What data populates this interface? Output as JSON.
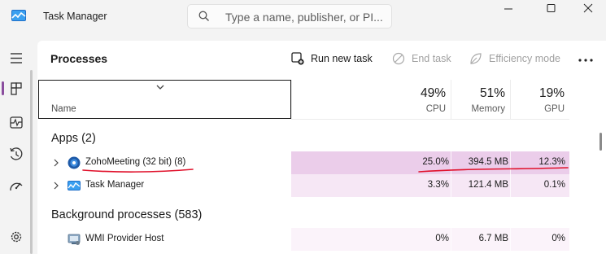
{
  "window": {
    "title": "Task Manager",
    "search_placeholder": "Type a name, publisher, or PI..."
  },
  "nav": {
    "items": [
      "menu-icon",
      "processes-icon",
      "performance-icon",
      "app-history-icon",
      "startup-apps-icon",
      "settings-icon"
    ],
    "active": "processes",
    "accent": "#8a4d9e"
  },
  "toolbar": {
    "page_title": "Processes",
    "run_new_task": "Run new task",
    "end_task": "End task",
    "efficiency_mode": "Efficiency mode"
  },
  "columns": {
    "name": "Name",
    "cpu": {
      "pct": "49%",
      "label": "CPU"
    },
    "memory": {
      "pct": "51%",
      "label": "Memory"
    },
    "gpu": {
      "pct": "19%",
      "label": "GPU"
    }
  },
  "groups": {
    "apps": "Apps (2)",
    "background": "Background processes (583)"
  },
  "rows": [
    {
      "name": "ZohoMeeting (32 bit) (8)",
      "cpu": "25.0%",
      "memory": "394.5 MB",
      "gpu": "12.3%"
    },
    {
      "name": "Task Manager",
      "cpu": "3.3%",
      "memory": "121.4 MB",
      "gpu": "0.1%"
    },
    {
      "name": "WMI Provider Host",
      "cpu": "0%",
      "memory": "6.7 MB",
      "gpu": "0%"
    }
  ],
  "colors": {
    "highlight_strong": "#ebcdea",
    "highlight_light": "#f6e7f5",
    "annotation_red": "#e0112b"
  }
}
